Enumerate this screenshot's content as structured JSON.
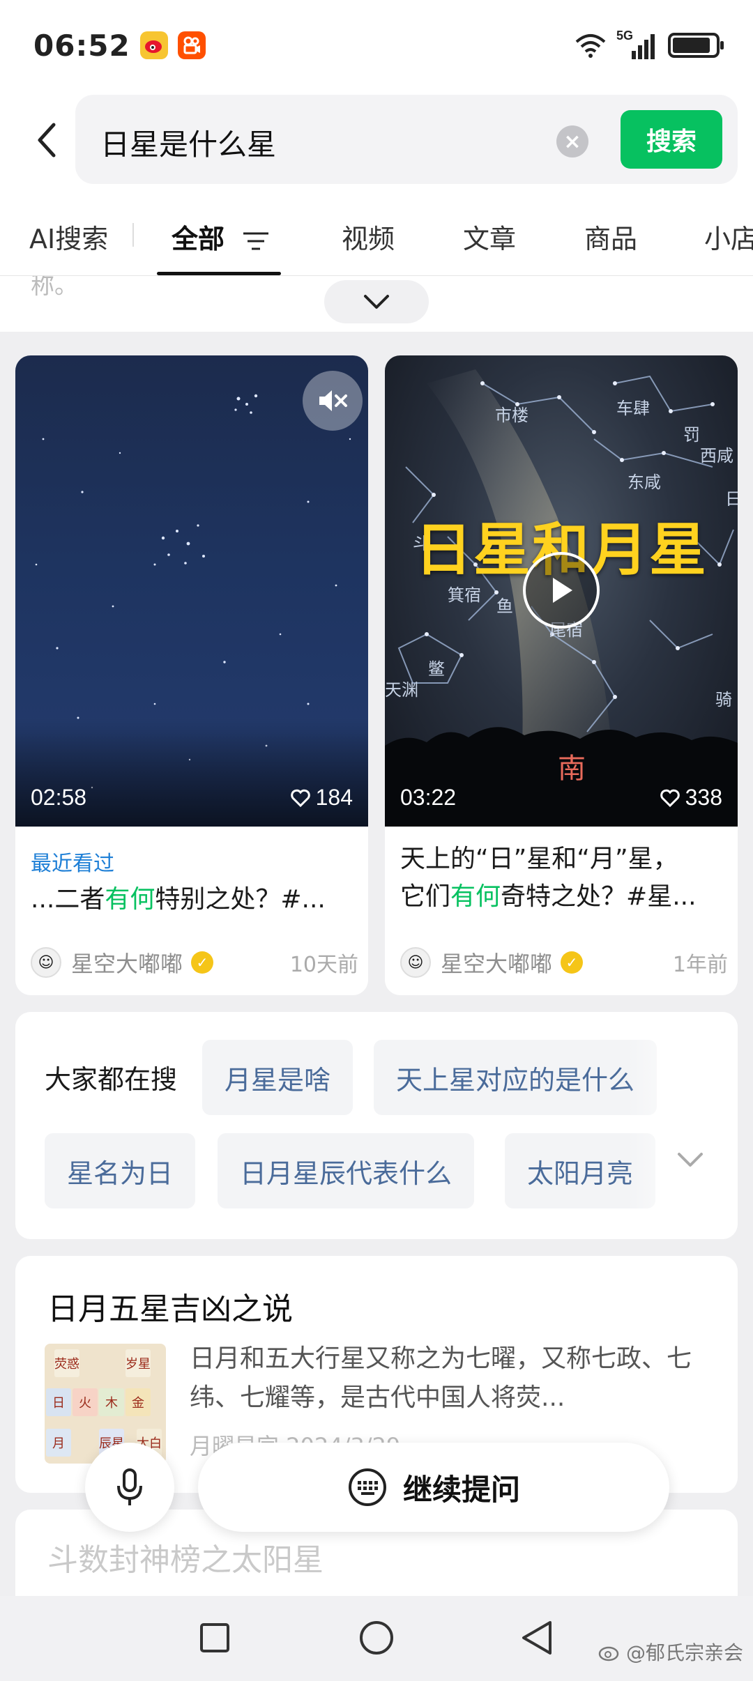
{
  "status_bar": {
    "time": "06:52",
    "network": "5G"
  },
  "search": {
    "query": "日星是什么星",
    "button_label": "搜索",
    "accent_color": "#07c160"
  },
  "tabs": [
    {
      "label": "AI搜索"
    },
    {
      "label": "全部"
    },
    {
      "label": "视频"
    },
    {
      "label": "文章"
    },
    {
      "label": "商品"
    },
    {
      "label": "小店"
    }
  ],
  "faded_top_text": "称。",
  "videos": [
    {
      "duration": "02:58",
      "likes": "184",
      "recent_tag": "最近看过",
      "title_pre": "...二者",
      "title_hl": "有何",
      "title_post": "特别之处？#...",
      "author": "星空大嘟嘟",
      "time_ago": "10天前"
    },
    {
      "duration": "03:22",
      "likes": "338",
      "overlay_title": "日星和月星",
      "overlay_direction": "南",
      "title_line1": "天上的“日”星和“月”星，",
      "title_pre": "它们",
      "title_hl": "有何",
      "title_post": "奇特之处？#星...",
      "author": "星空大嘟嘟",
      "time_ago": "1年前",
      "star_labels": [
        "市楼",
        "车肆",
        "罚",
        "西咸",
        "东咸",
        "日",
        "斗",
        "箕宿",
        "鱼",
        "尾宿",
        "鳖",
        "天渊",
        "骑"
      ]
    }
  ],
  "people_search": {
    "label": "大家都在搜",
    "chips_row1": [
      "月星是啥",
      "天上星对应的是什么"
    ],
    "chips_row2": [
      "星名为日",
      "日月星辰代表什么",
      "太阳月亮"
    ]
  },
  "article": {
    "title": "日月五星吉凶之说",
    "summary": "日月和五大行星又称之为七曜，又称七政、七纬、七耀等，是古代中国人将荧...",
    "meta": "月曜星宫 2024/3/29",
    "image_text": [
      "荧惑",
      "岁星",
      "日",
      "火",
      "木",
      "金",
      "月",
      "辰星",
      "太白"
    ]
  },
  "article_2": {
    "title": "斗数封神榜之太阳星"
  },
  "action_bar": {
    "ask_label": "继续提问"
  },
  "watermark": "@郁氏宗亲会"
}
